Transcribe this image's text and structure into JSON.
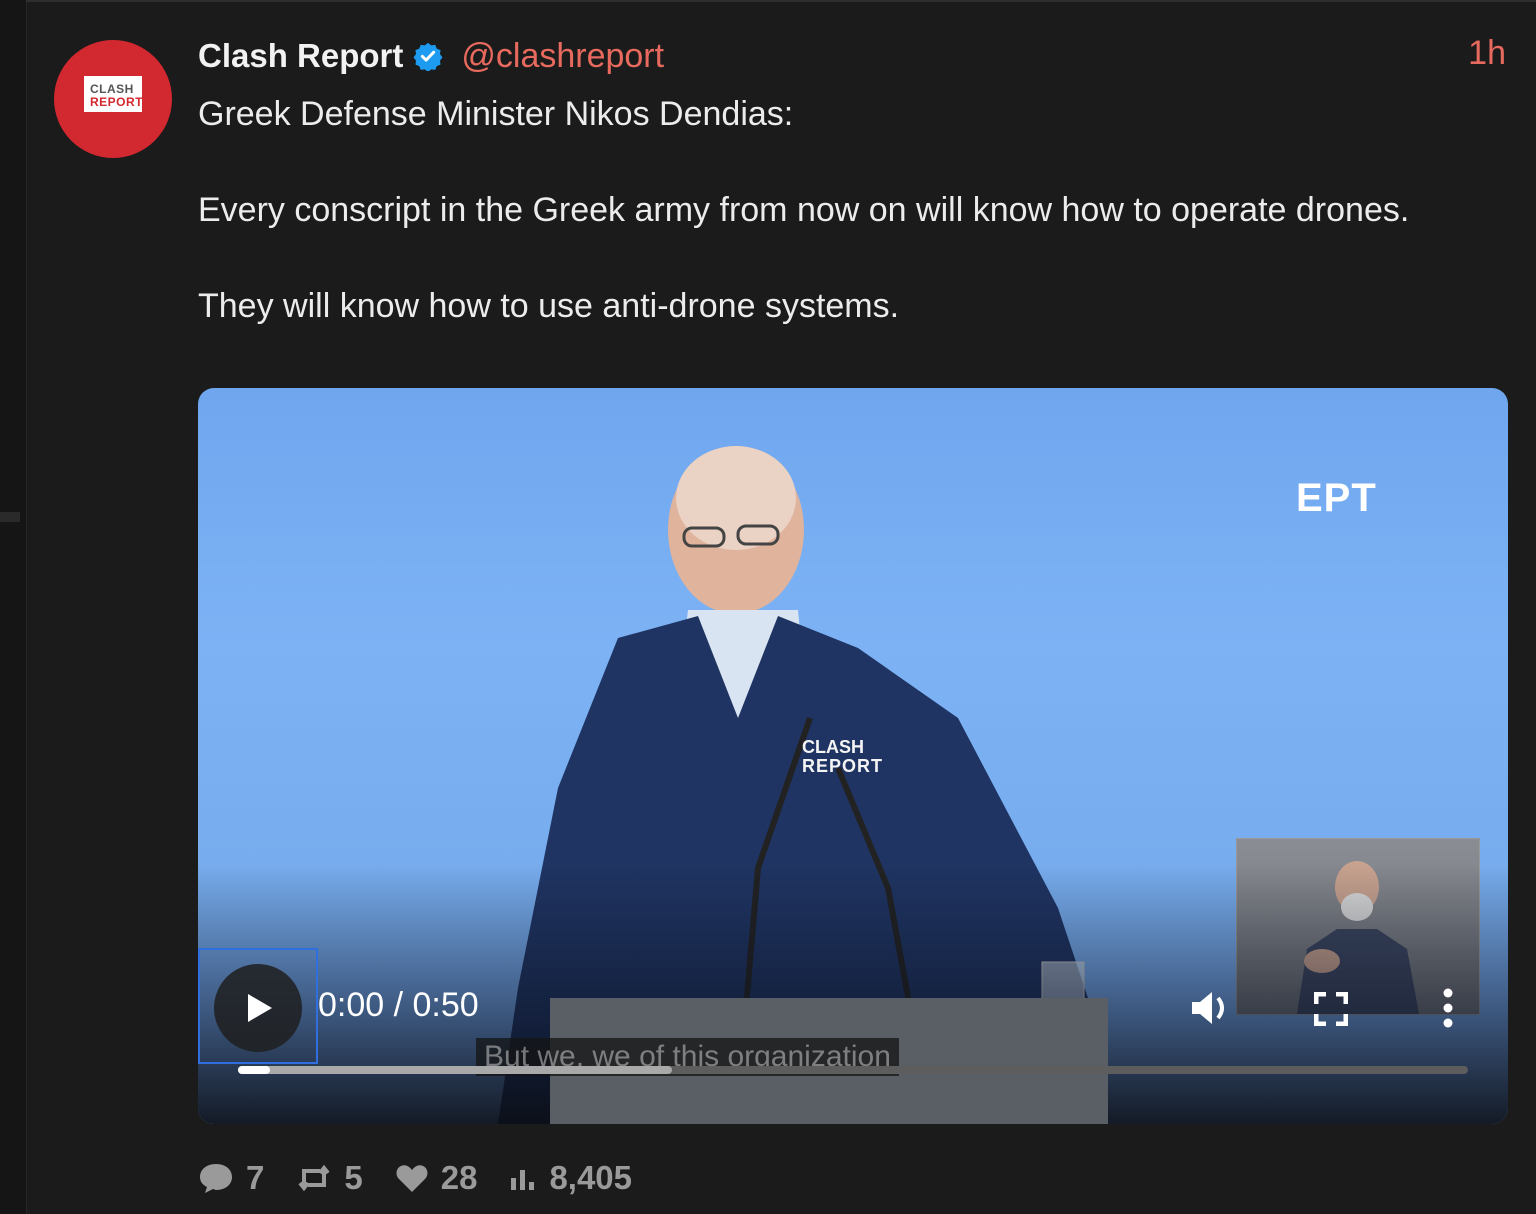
{
  "tweet": {
    "display_name": "Clash Report",
    "handle": "@clashreport",
    "time": "1h",
    "avatar": {
      "line1": "CLASH",
      "line2": "REPORT"
    },
    "text": {
      "p1": "Greek Defense Minister Nikos Dendias:",
      "p2": "Every conscript in the Greek army from now on will know how to operate drones.",
      "p3": "They will know how to use anti-drone systems."
    }
  },
  "video": {
    "channel_logo": "EPT",
    "watermark_line1": "CLASH",
    "watermark_line2": "REPORT",
    "subtitle": "But we, we of this organization",
    "time_readout": "0:00 / 0:50",
    "progress_played_fraction": 0.026,
    "progress_buffered_fraction": 0.353
  },
  "stats": {
    "replies": "7",
    "reposts": "5",
    "likes": "28",
    "views": "8,405"
  },
  "colors": {
    "background": "#1b1b1b",
    "accent_handle": "#e86a5e",
    "verified": "#1d9bf0",
    "avatar_red": "#d2282f",
    "muted": "#9a9a9a"
  },
  "icons": [
    "verified-badge-icon",
    "play-icon",
    "volume-icon",
    "fullscreen-icon",
    "more-vertical-icon",
    "reply-icon",
    "repost-icon",
    "like-icon",
    "views-icon"
  ]
}
